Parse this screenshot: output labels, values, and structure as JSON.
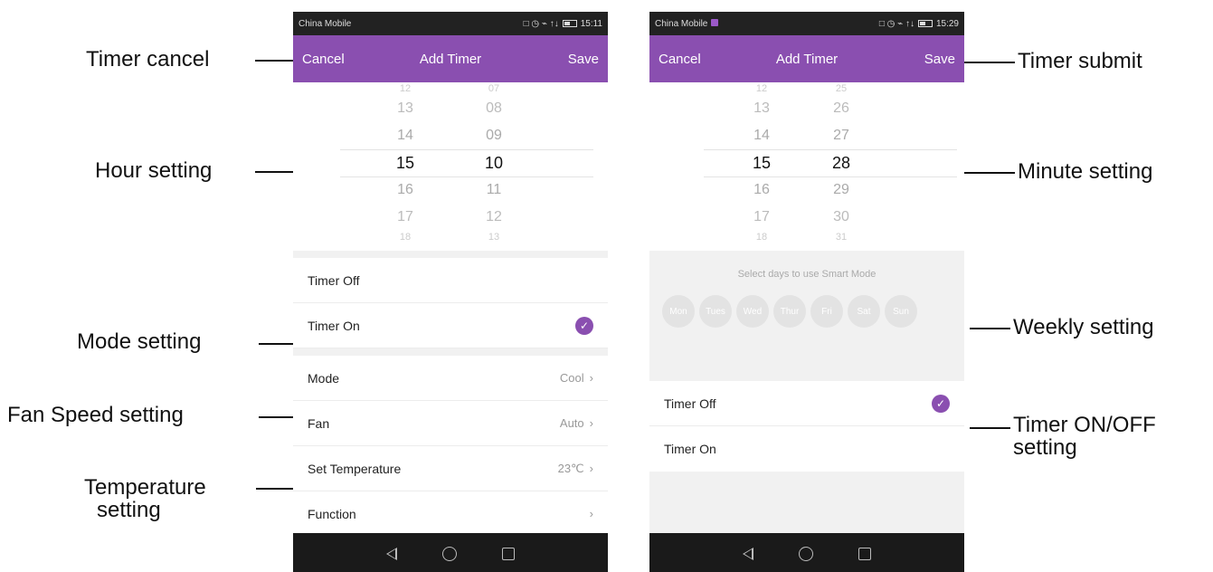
{
  "annotations": {
    "timer_cancel": "Timer cancel",
    "hour_setting": "Hour setting",
    "mode_setting": "Mode setting",
    "fan_speed_setting": "Fan Speed setting",
    "temperature_setting_1": "Temperature",
    "temperature_setting_2": "setting",
    "timer_submit": "Timer submit",
    "minute_setting": "Minute setting",
    "weekly_setting": "Weekly setting",
    "timer_onoff_1": "Timer ON/OFF",
    "timer_onoff_2": "setting"
  },
  "left_phone": {
    "status": {
      "carrier": "China Mobile",
      "icons": "□ ◷ ⌁ ↑↓",
      "time": "15:11"
    },
    "appbar": {
      "cancel": "Cancel",
      "title": "Add Timer",
      "save": "Save"
    },
    "hours": [
      "12",
      "13",
      "14",
      "15",
      "16",
      "17",
      "18"
    ],
    "minutes": [
      "07",
      "08",
      "09",
      "10",
      "11",
      "12",
      "13"
    ],
    "timer_off": "Timer Off",
    "timer_on": "Timer On",
    "timer_on_checked": true,
    "settings": [
      {
        "label": "Mode",
        "value": "Cool"
      },
      {
        "label": "Fan",
        "value": "Auto"
      },
      {
        "label": "Set Temperature",
        "value": "23℃"
      },
      {
        "label": "Function",
        "value": ""
      }
    ],
    "chevron": "›"
  },
  "right_phone": {
    "status": {
      "carrier": "China Mobile",
      "icons": "□ ◷ ⌁ ↑↓",
      "time": "15:29"
    },
    "appbar": {
      "cancel": "Cancel",
      "title": "Add Timer",
      "save": "Save"
    },
    "hours": [
      "12",
      "13",
      "14",
      "15",
      "16",
      "17",
      "18"
    ],
    "minutes": [
      "25",
      "26",
      "27",
      "28",
      "29",
      "30",
      "31"
    ],
    "smart_label": "Select days to use Smart Mode",
    "days": [
      "Mon",
      "Tues",
      "Wed",
      "Thur",
      "Fri",
      "Sat",
      "Sun"
    ],
    "timer_off": "Timer Off",
    "timer_on": "Timer On",
    "timer_off_checked": true
  },
  "colors": {
    "accent": "#8a4fb0",
    "statusbar": "#222222",
    "navbar": "#1a1a1a"
  }
}
